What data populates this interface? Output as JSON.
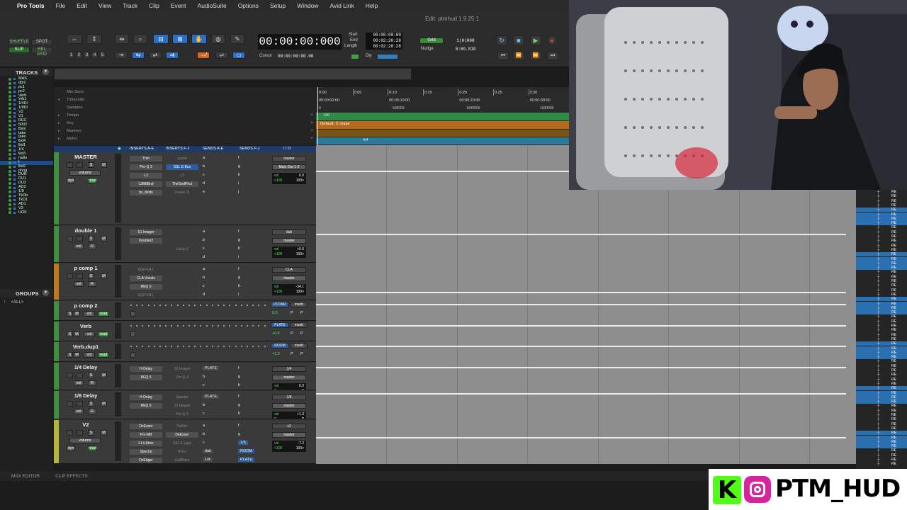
{
  "menu": {
    "apple": "",
    "items": [
      "Pro Tools",
      "File",
      "Edit",
      "View",
      "Track",
      "Clip",
      "Event",
      "AudioSuite",
      "Options",
      "Setup",
      "Window",
      "Avid Link",
      "Help"
    ]
  },
  "window_title": "Edit: ptmhud 1.9.25 1",
  "toolbar": {
    "modes": [
      "SHUFFLE",
      "SPOT",
      "SLIP",
      "REL GRID"
    ],
    "zoom_presets": [
      "1",
      "2",
      "3",
      "4",
      "5"
    ],
    "main_counter": "00:00:00:000",
    "start_label": "Start",
    "end_label": "End",
    "length_label": "Length",
    "start": "00:00:00:00",
    "end": "00:02:20:28",
    "length": "00:02:20:28",
    "cursor_label": "Cursor",
    "cursor_value": "00:00:00:00.00",
    "dly_label": "Dly",
    "grid_label": "Grid",
    "grid_value": "1|0|000",
    "nudge_label": "Nudge",
    "nudge_value": "0:00.010"
  },
  "tracks_panel": {
    "header": "TRACKS",
    "items": [
      "MAS",
      "dbl1",
      "pc1",
      "pc2",
      "Verb",
      "Vrb1",
      "1/4Dl",
      "1/8Dl",
      "V2",
      "V1",
      "REC",
      "5002",
      "Bsm",
      "take",
      "take",
      "lkd4",
      "lkd1",
      "1/4",
      "lkd3",
      "radio",
      "f",
      "lkd2",
      "phng",
      "DUB",
      "DU1",
      "DU2",
      "AD2",
      "1/8",
      "TkDb",
      "TkD1",
      "AD1",
      "V3",
      "HOK"
    ],
    "selected_index": 20
  },
  "groups_panel": {
    "header": "GROUPS",
    "items": [
      {
        "id": "!",
        "name": "<ALL>"
      }
    ]
  },
  "rulers": {
    "labels": [
      "Min:Secs",
      "Timecode",
      "Samples",
      "Tempo",
      "Key",
      "Markers",
      "Meter"
    ],
    "min_secs_ticks": [
      "0:00",
      "0:05",
      "0:10",
      "0:15",
      "0:20",
      "0:25",
      "0:30"
    ],
    "timecode_ticks": [
      "00:00:00:00",
      "00:00:10:00",
      "00:00:20:00",
      "00:00:30:00"
    ],
    "samples_ticks": [
      "0",
      "500000",
      "1000000",
      "1500000"
    ],
    "tempo_value": "140",
    "key_value": "Default: C major",
    "meter_value": "4/4"
  },
  "mixer_header": [
    "INSERTS A-E",
    "INSERTS F-J",
    "SENDS A-E",
    "SENDS F-J",
    "I / O"
  ],
  "tracks": [
    {
      "name": "MASTER",
      "color": "#3f8f3f",
      "sub": [
        "volume",
        "dyn",
        "read"
      ],
      "inserts_ae": [
        "Trim",
        "Pro-Q 3",
        "L2",
        "L3MltBnd",
        "bx_limits"
      ],
      "inserts_fj": [
        "ozone",
        "SSL G Bus",
        "L3",
        "TheGodPrtcl",
        "Ozone 11"
      ],
      "inserts_fj_state": [
        "off",
        "blue",
        "off",
        "on",
        "off"
      ],
      "sends_ae": [
        "a",
        "b",
        "c",
        "d",
        "e"
      ],
      "sends_fj": [
        "f",
        "g",
        "h",
        "i",
        "j"
      ],
      "io": [
        "master",
        "Main Out 1-2"
      ],
      "vol": "0.0",
      "pan": [
        "<100",
        "100>"
      ]
    },
    {
      "name": "double 1",
      "color": "#3f8f3f",
      "sub": [
        "vol",
        "R"
      ],
      "inserts_ae": [
        "S1 Imager",
        "Doubler2"
      ],
      "inserts_fj": [
        "",
        "",
        "Lossy 2"
      ],
      "inserts_fj_state": [
        "off",
        "off",
        "off"
      ],
      "sends_ae": [
        "a",
        "b",
        "c",
        "d"
      ],
      "sends_fj": [
        "f",
        "g",
        "h",
        "i"
      ],
      "io": [
        "dub",
        "master"
      ],
      "vol": "+0.6",
      "pan": [
        "<100",
        "100>"
      ]
    },
    {
      "name": "p comp 1",
      "color": "#c07a1e",
      "sub": [
        "vol",
        "R"
      ],
      "inserts_ae": [
        "EQP-1A L",
        "CLA Vocals",
        "REQ 6",
        "EQP-1A L"
      ],
      "inserts_ae_state": [
        "off",
        "on",
        "on",
        "off"
      ],
      "inserts_fj": [],
      "inserts_fj_state": [],
      "sends_ae": [
        "a",
        "b",
        "c",
        "d"
      ],
      "sends_fj": [
        "f",
        "g",
        "h",
        "i"
      ],
      "io": [
        "CLA",
        "master"
      ],
      "vol": "-34.1",
      "pan": [
        "<100",
        "100>"
      ]
    },
    {
      "name": "p comp 2",
      "color": "#3f8f3f",
      "sub": [
        "S",
        "M",
        "vol",
        "read"
      ],
      "io": [
        "PCOM2",
        "mastr"
      ],
      "vol": "0.0",
      "pp": [
        "P",
        "P"
      ]
    },
    {
      "name": "Verb",
      "color": "#3f8f3f",
      "sub": [
        "S",
        "M",
        "vol",
        "read"
      ],
      "io": [
        "PLATE",
        "mastr"
      ],
      "vol": "+0.6",
      "pp": [
        "P",
        "P"
      ]
    },
    {
      "name": "Verb.dup1",
      "color": "#3f8f3f",
      "sub": [
        "S",
        "M",
        "vol",
        "read"
      ],
      "io": [
        "ROOM",
        "mastr"
      ],
      "vol": "+1.2",
      "pp": [
        "P",
        "P"
      ]
    },
    {
      "name": "1/4 Delay",
      "color": "#3f8f3f",
      "sub": [
        "vol",
        "R"
      ],
      "inserts_ae": [
        "H-Delay",
        "REQ 6"
      ],
      "inserts_fj": [
        "S1 Imager",
        "Pro-Q 3"
      ],
      "inserts_fj_state": [
        "off",
        "off"
      ],
      "sends_ae": [
        "PLATE",
        "b",
        "c"
      ],
      "sends_fj": [
        "f",
        "g",
        "h"
      ],
      "io": [
        "1/4",
        "master"
      ],
      "vol": "0.0",
      "pp": [
        "P",
        "P"
      ]
    },
    {
      "name": "1/8 Delay",
      "color": "#3f8f3f",
      "sub": [
        "vol",
        "R"
      ],
      "inserts_ae": [
        "H-Delay",
        "REQ 6"
      ],
      "inserts_fj": [
        "Spectre",
        "S1 Imager",
        "Pro-Q 3"
      ],
      "inserts_fj_state": [
        "off",
        "off",
        "off"
      ],
      "sends_ae": [
        "PLATE",
        "b",
        "c"
      ],
      "sends_fj": [
        "f",
        "g",
        "h"
      ],
      "io": [
        "1/8",
        "master"
      ],
      "vol": "+1.3",
      "pp": [
        "P",
        "P"
      ]
    },
    {
      "name": "V2",
      "color": "#b5b53a",
      "sub": [
        "volume",
        "dyn",
        "read"
      ],
      "inserts_ae": [
        "DeEsser",
        "Pro-MB",
        "L1+Ultmx",
        "Spectre",
        "DeEdger"
      ],
      "inserts_fj": [
        "RvlbVc",
        "DeEsser",
        "SSL E Lgcy",
        "RVox",
        "GulfBass"
      ],
      "inserts_fj_state": [
        "off",
        "on",
        "off",
        "off",
        "off"
      ],
      "sends_ae": [
        "a",
        "b",
        "c",
        "dub",
        "1/4"
      ],
      "sends_fj": [
        "f",
        "g",
        "1/8",
        "ROOM",
        "PLATE"
      ],
      "io": [
        "v2",
        "master"
      ],
      "vol": "-7.2",
      "pan": [
        "<100",
        "100>"
      ]
    }
  ],
  "right_column": {
    "items": [
      "RE",
      "RE",
      "RE",
      "RE",
      "RE",
      "RE",
      "RE",
      "RE",
      "RE",
      "RE",
      "RE",
      "RE",
      "RE",
      "RE",
      "RE",
      "RE",
      "RE",
      "RE",
      "RE",
      "RE",
      "RE",
      "RE",
      "RE",
      "RE",
      "RE",
      "RE",
      "RE",
      "RE",
      "RE",
      "RE",
      "RE",
      "RE",
      "RE",
      "RE",
      "RE",
      "RE",
      "RE",
      "RE",
      "RE",
      "RE",
      "RE",
      "RE",
      "RE",
      "RE",
      "RE",
      "RE",
      "RE",
      "RE",
      "RE",
      "RE",
      "RE",
      "RE",
      "RE",
      "RE",
      "RE",
      "RE",
      "RE",
      "RE",
      "RE",
      "RE",
      "RE",
      "RE"
    ]
  },
  "bottom": {
    "midi_editor": "MIDI EDITOR",
    "clip_effects": "CLIP EFFECTS"
  },
  "overlay": {
    "handle": "PTM_HUD"
  },
  "colors": {
    "accent": "#1e4d8d",
    "green": "#3f8f3f",
    "orange": "#c07a1e",
    "kick": "#53fc18",
    "instagram": "#d6249f"
  }
}
